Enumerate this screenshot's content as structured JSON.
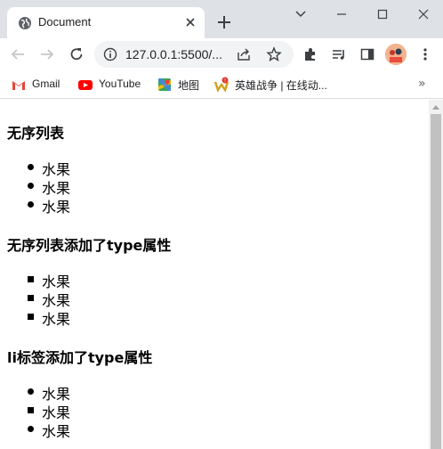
{
  "browser": {
    "tab_title": "Document",
    "url": "127.0.0.1:5500/...",
    "bookmarks": [
      {
        "label": "Gmail",
        "icon": "gmail-icon"
      },
      {
        "label": "YouTube",
        "icon": "youtube-icon"
      },
      {
        "label": "地图",
        "icon": "maps-icon"
      },
      {
        "label": "英雄战争 | 在线动...",
        "icon": "game-icon"
      }
    ],
    "more_bookmarks": "»"
  },
  "page": {
    "sections": [
      {
        "heading": "无序列表",
        "items": [
          "水果",
          "水果",
          "水果"
        ],
        "markers": [
          "disc",
          "disc",
          "disc"
        ]
      },
      {
        "heading": "无序列表添加了type属性",
        "items": [
          "水果",
          "水果",
          "水果"
        ],
        "markers": [
          "square",
          "square",
          "square"
        ]
      },
      {
        "heading": "li标签添加了type属性",
        "items": [
          "水果",
          "水果",
          "水果"
        ],
        "markers": [
          "disc",
          "square",
          "disc"
        ]
      }
    ]
  },
  "colors": {
    "titlebar": "#dee1e6",
    "omnibox": "#f1f3f4",
    "youtube_red": "#ff0000"
  }
}
